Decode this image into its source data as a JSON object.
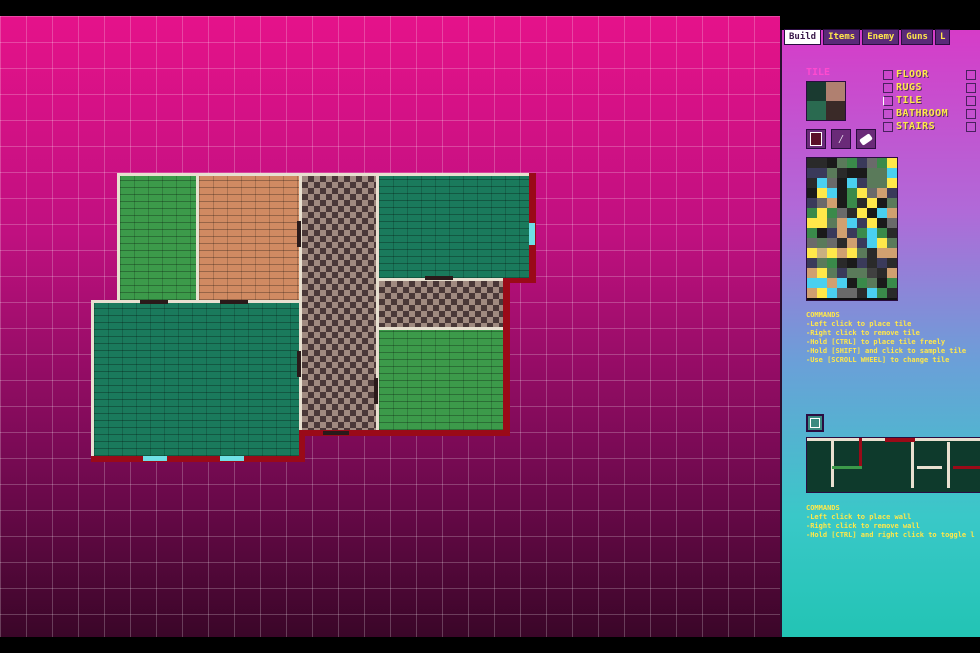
{
  "tabs": [
    {
      "label": "Build",
      "active": true
    },
    {
      "label": "Items",
      "active": false
    },
    {
      "label": "Enemy",
      "active": false
    },
    {
      "label": "Guns",
      "active": false
    },
    {
      "label": "L",
      "active": false
    }
  ],
  "tile_section": {
    "title": "TILE"
  },
  "categories": [
    {
      "label": "FLOOR",
      "checked": false
    },
    {
      "label": "RUGS",
      "checked": false
    },
    {
      "label": "TILE",
      "checked": true
    },
    {
      "label": "BATHROOM",
      "checked": false
    },
    {
      "label": "STAIRS",
      "checked": false
    }
  ],
  "tools": [
    {
      "name": "pencil",
      "icon": "brush-icon"
    },
    {
      "name": "picker",
      "icon": "eyedropper-icon"
    },
    {
      "name": "eraser",
      "icon": "eraser-icon"
    }
  ],
  "tile_commands": {
    "title": "COMMANDS",
    "lines": [
      "-Left click to place tile",
      "-Right click to remove tile",
      "-Hold [CTRL] to place tile freely",
      "-Hold [SHIFT] and click to sample tile",
      "-Use [SCROLL WHEEL] to change tile"
    ]
  },
  "wall_commands": {
    "title": "COMMANDS",
    "lines": [
      "-Left click to place wall",
      "-Right click to remove wall",
      "-Hold [CTRL] and right click to toggle l"
    ]
  },
  "colors": {
    "canvas_top": "#e5128a",
    "canvas_bottom": "#3a0628",
    "panel_top": "#d63cc8",
    "panel_bottom": "#22c4b4",
    "label_yellow": "#ffe84a",
    "wall_red": "#9a0a18",
    "door_cyan": "#6fe0e6"
  }
}
